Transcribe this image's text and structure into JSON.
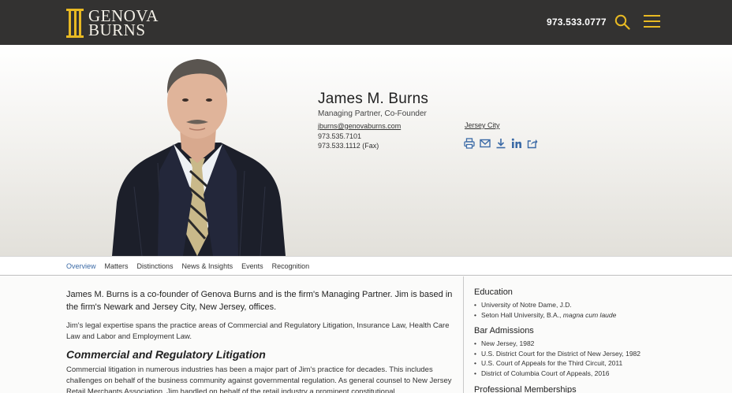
{
  "header": {
    "logo_line1": "GENOVA",
    "logo_line2": "BURNS",
    "phone": "973.533.0777",
    "search_icon": "search-icon",
    "menu_icon": "menu-icon",
    "accent": "#e8b923",
    "bg": "#333231"
  },
  "profile": {
    "name": "James M. Burns",
    "title": "Managing Partner, Co-Founder",
    "email": "jburns@genovaburns.com",
    "phone": "973.535.7101",
    "fax": "973.533.1112 (Fax)",
    "office": "Jersey City",
    "actions": [
      "print-icon",
      "email-icon",
      "download-icon",
      "linkedin-icon",
      "share-icon"
    ],
    "link_color": "#3b6aa6"
  },
  "tabs": [
    "Overview",
    "Matters",
    "Distinctions",
    "News & Insights",
    "Events",
    "Recognition"
  ],
  "active_tab": "Overview",
  "main": {
    "lead": "James M. Burns is a co-founder of Genova Burns and is the firm's Managing Partner. Jim is based in the firm's Newark and Jersey City, New Jersey, offices.",
    "para1": "Jim's legal expertise spans the practice areas of Commercial and Regulatory Litigation, Insurance Law, Health Care Law and Labor and Employment Law.",
    "subhead": "Commercial and Regulatory Litigation",
    "para2": "Commercial litigation in numerous industries has been a major part of Jim's practice for decades. This includes challenges on behalf of the business community against governmental regulation. As general counsel to New Jersey Retail Merchants Association, Jim handled on behalf of the retail industry a prominent constitutional"
  },
  "sidebar": {
    "education_heading": "Education",
    "education": [
      {
        "text": "University of Notre Dame, J.D.",
        "em": ""
      },
      {
        "text": "Seton Hall University, B.A., ",
        "em": "magna cum laude"
      }
    ],
    "bar_heading": "Bar Admissions",
    "bar": [
      "New Jersey, 1982",
      "U.S. District Court for the District of New Jersey, 1982",
      "U.S. Court of Appeals for the Third Circuit, 2011",
      "District of Columbia Court of Appeals, 2016"
    ],
    "memberships_heading": "Professional Memberships"
  }
}
